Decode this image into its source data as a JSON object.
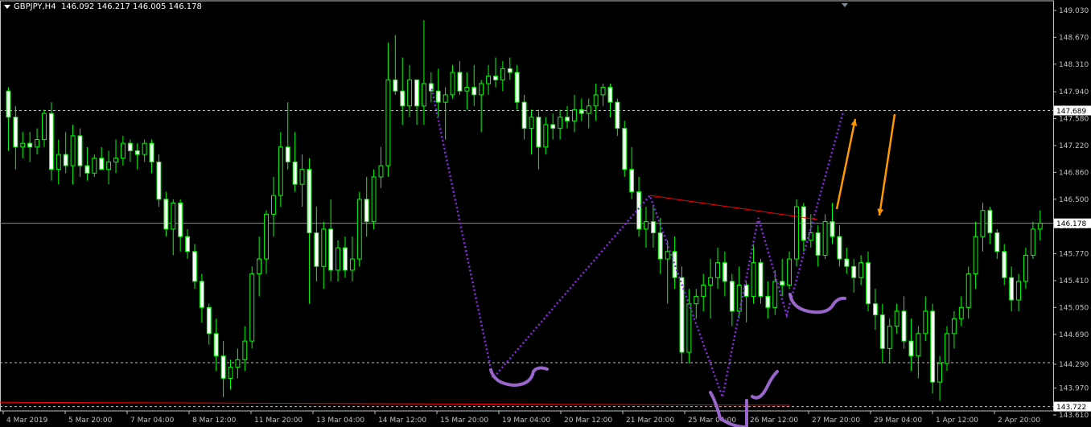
{
  "header": {
    "symbol_timeframe": "GBPJPY,H4",
    "ohlc": "146.092 146.217 146.005 146.178"
  },
  "colors": {
    "background": "#000000",
    "axis": "#c0c0c0",
    "candle": "#00ff00",
    "candle_alt": "#ffffff",
    "dashed_level": "#c0c0c0",
    "bid_line": "#7f8c99",
    "support_line": "#ff0000",
    "pattern": "#8a2be2",
    "handwriting": "#9966cc",
    "arrow": "#ff9900"
  },
  "chart_data": {
    "type": "candlestick",
    "symbol": "GBPJPY",
    "timeframe": "H4",
    "ylim": [
      143.61,
      149.03
    ],
    "yticks": [
      "149.030",
      "148.670",
      "148.310",
      "147.940",
      "147.580",
      "147.220",
      "146.860",
      "146.500",
      "146.140",
      "145.770",
      "145.410",
      "145.050",
      "144.690",
      "144.290",
      "143.970",
      "143.610"
    ],
    "xticks": [
      "4 Mar 2019",
      "5 Mar 20:00",
      "7 Mar 04:00",
      "8 Mar 12:00",
      "11 Mar 20:00",
      "13 Mar 04:00",
      "14 Mar 12:00",
      "15 Mar 20:00",
      "19 Mar 04:00",
      "20 Mar 12:00",
      "21 Mar 20:00",
      "25 Mar 04:00",
      "26 Mar 12:00",
      "27 Mar 20:00",
      "29 Mar 04:00",
      "1 Apr 12:00",
      "2 Apr 20:00"
    ],
    "price_labels": [
      {
        "label": "147.689",
        "value": 147.689,
        "style": "dashed"
      },
      {
        "label": "146.178",
        "value": 146.178,
        "style": "bid"
      },
      {
        "label": "143.722",
        "value": 143.722,
        "style": "dashed"
      }
    ],
    "levels": [
      147.689,
      144.31,
      143.722
    ],
    "bid": 146.178,
    "candles": [
      [
        147.95,
        148.0,
        147.15,
        147.6
      ],
      [
        147.6,
        147.75,
        146.9,
        147.2
      ],
      [
        147.2,
        147.4,
        147.05,
        147.25
      ],
      [
        147.25,
        147.4,
        147.0,
        147.2
      ],
      [
        147.2,
        147.45,
        147.1,
        147.3
      ],
      [
        147.3,
        147.7,
        147.2,
        147.65
      ],
      [
        147.65,
        147.8,
        146.75,
        146.9
      ],
      [
        146.9,
        147.3,
        146.7,
        147.1
      ],
      [
        147.1,
        147.4,
        146.85,
        146.95
      ],
      [
        146.95,
        147.5,
        146.7,
        147.35
      ],
      [
        147.35,
        147.45,
        146.8,
        146.95
      ],
      [
        146.95,
        147.2,
        146.75,
        146.85
      ],
      [
        146.85,
        147.1,
        146.8,
        147.05
      ],
      [
        147.05,
        147.2,
        146.95,
        146.9
      ],
      [
        146.9,
        147.15,
        146.7,
        147.0
      ],
      [
        147.0,
        147.3,
        146.85,
        147.05
      ],
      [
        147.05,
        147.35,
        146.95,
        147.25
      ],
      [
        147.25,
        147.3,
        147.0,
        147.15
      ],
      [
        147.15,
        147.25,
        146.9,
        147.1
      ],
      [
        147.1,
        147.3,
        147.0,
        147.25
      ],
      [
        147.25,
        147.3,
        146.85,
        147.0
      ],
      [
        147.0,
        147.1,
        146.4,
        146.5
      ],
      [
        146.5,
        146.6,
        146.0,
        146.1
      ],
      [
        146.1,
        146.5,
        145.75,
        146.45
      ],
      [
        146.45,
        146.5,
        145.8,
        146.0
      ],
      [
        146.0,
        146.1,
        145.7,
        145.8
      ],
      [
        145.8,
        145.9,
        145.3,
        145.4
      ],
      [
        145.4,
        145.5,
        144.85,
        145.05
      ],
      [
        145.05,
        145.1,
        144.55,
        144.7
      ],
      [
        144.7,
        144.9,
        144.2,
        144.4
      ],
      [
        144.4,
        144.6,
        143.85,
        144.1
      ],
      [
        144.1,
        144.35,
        143.95,
        144.25
      ],
      [
        144.25,
        144.5,
        144.1,
        144.35
      ],
      [
        144.35,
        144.8,
        144.2,
        144.6
      ],
      [
        144.6,
        145.6,
        144.5,
        145.5
      ],
      [
        145.5,
        146.0,
        145.2,
        145.7
      ],
      [
        145.7,
        146.35,
        145.5,
        146.3
      ],
      [
        146.3,
        146.8,
        146.0,
        146.55
      ],
      [
        146.55,
        147.4,
        146.4,
        147.2
      ],
      [
        147.2,
        147.8,
        146.9,
        147.0
      ],
      [
        147.0,
        147.4,
        146.6,
        146.7
      ],
      [
        146.7,
        147.1,
        146.4,
        146.9
      ],
      [
        146.9,
        147.05,
        145.1,
        146.05
      ],
      [
        146.05,
        146.4,
        145.4,
        145.6
      ],
      [
        145.6,
        146.2,
        145.3,
        146.1
      ],
      [
        146.1,
        146.5,
        145.4,
        145.55
      ],
      [
        145.55,
        145.95,
        145.4,
        145.85
      ],
      [
        145.85,
        146.0,
        145.45,
        145.55
      ],
      [
        145.55,
        146.0,
        145.4,
        145.7
      ],
      [
        145.7,
        146.6,
        145.6,
        146.5
      ],
      [
        146.5,
        146.8,
        146.0,
        146.2
      ],
      [
        146.2,
        146.9,
        146.1,
        146.8
      ],
      [
        146.8,
        147.2,
        146.65,
        146.95
      ],
      [
        146.95,
        148.6,
        146.8,
        148.1
      ],
      [
        148.1,
        148.7,
        147.9,
        147.95
      ],
      [
        147.95,
        148.4,
        147.5,
        147.75
      ],
      [
        147.75,
        148.3,
        147.6,
        148.1
      ],
      [
        148.1,
        148.1,
        147.5,
        147.75
      ],
      [
        147.75,
        148.9,
        147.5,
        148.05
      ],
      [
        148.05,
        148.2,
        147.8,
        147.95
      ],
      [
        147.95,
        148.25,
        147.6,
        147.8
      ],
      [
        147.8,
        148.0,
        147.3,
        147.9
      ],
      [
        147.9,
        148.3,
        147.85,
        148.2
      ],
      [
        148.2,
        148.35,
        147.9,
        147.95
      ],
      [
        147.95,
        148.2,
        147.7,
        148.0
      ],
      [
        148.0,
        148.3,
        147.75,
        147.9
      ],
      [
        147.9,
        148.1,
        147.4,
        148.05
      ],
      [
        148.05,
        148.3,
        147.9,
        148.15
      ],
      [
        148.15,
        148.4,
        148.0,
        148.1
      ],
      [
        148.1,
        148.35,
        147.95,
        148.25
      ],
      [
        148.25,
        148.4,
        148.1,
        148.2
      ],
      [
        148.2,
        148.3,
        147.7,
        147.8
      ],
      [
        147.8,
        147.9,
        147.3,
        147.45
      ],
      [
        147.45,
        147.7,
        147.1,
        147.6
      ],
      [
        147.6,
        147.7,
        146.9,
        147.2
      ],
      [
        147.2,
        147.6,
        147.1,
        147.5
      ],
      [
        147.5,
        147.65,
        147.3,
        147.45
      ],
      [
        147.45,
        147.7,
        147.3,
        147.6
      ],
      [
        147.6,
        147.75,
        147.45,
        147.55
      ],
      [
        147.55,
        147.9,
        147.4,
        147.7
      ],
      [
        147.7,
        147.85,
        147.55,
        147.65
      ],
      [
        147.65,
        147.85,
        147.45,
        147.75
      ],
      [
        147.75,
        148.05,
        147.55,
        147.9
      ],
      [
        147.9,
        148.05,
        147.75,
        148.0
      ],
      [
        148.0,
        148.05,
        147.6,
        147.8
      ],
      [
        147.8,
        147.85,
        147.35,
        147.45
      ],
      [
        147.45,
        147.55,
        146.8,
        146.9
      ],
      [
        146.9,
        147.2,
        146.5,
        146.6
      ],
      [
        146.6,
        146.8,
        146.0,
        146.1
      ],
      [
        146.1,
        146.4,
        145.85,
        146.2
      ],
      [
        146.2,
        146.4,
        145.85,
        146.05
      ],
      [
        146.05,
        146.25,
        145.5,
        145.7
      ],
      [
        145.7,
        145.95,
        145.1,
        145.8
      ],
      [
        145.8,
        146.0,
        145.3,
        145.45
      ],
      [
        145.45,
        145.6,
        144.3,
        144.45
      ],
      [
        144.45,
        145.3,
        144.3,
        145.1
      ],
      [
        145.1,
        145.3,
        144.9,
        145.2
      ],
      [
        145.2,
        145.5,
        145.0,
        145.35
      ],
      [
        145.35,
        145.7,
        144.9,
        145.45
      ],
      [
        145.45,
        145.85,
        145.3,
        145.65
      ],
      [
        145.65,
        145.8,
        145.2,
        145.4
      ],
      [
        145.4,
        145.5,
        144.8,
        145.0
      ],
      [
        145.0,
        145.6,
        144.9,
        145.35
      ],
      [
        145.35,
        145.4,
        144.85,
        145.2
      ],
      [
        145.2,
        145.9,
        145.1,
        145.65
      ],
      [
        145.65,
        145.7,
        145.1,
        145.2
      ],
      [
        145.2,
        145.4,
        144.9,
        145.05
      ],
      [
        145.05,
        145.55,
        144.95,
        145.4
      ],
      [
        145.4,
        145.7,
        145.2,
        145.35
      ],
      [
        145.35,
        145.8,
        145.3,
        145.7
      ],
      [
        145.7,
        146.5,
        145.6,
        146.4
      ],
      [
        146.4,
        146.45,
        145.8,
        145.95
      ],
      [
        145.95,
        146.3,
        145.85,
        146.05
      ],
      [
        146.05,
        146.15,
        145.6,
        145.75
      ],
      [
        145.75,
        146.3,
        145.7,
        146.2
      ],
      [
        146.2,
        146.45,
        145.9,
        146.0
      ],
      [
        146.0,
        146.15,
        145.6,
        145.7
      ],
      [
        145.7,
        145.85,
        145.5,
        145.6
      ],
      [
        145.6,
        145.7,
        145.25,
        145.45
      ],
      [
        145.45,
        145.75,
        145.35,
        145.65
      ],
      [
        145.65,
        145.8,
        145.0,
        145.1
      ],
      [
        145.1,
        145.3,
        144.75,
        144.95
      ],
      [
        144.95,
        145.1,
        144.3,
        144.5
      ],
      [
        144.5,
        144.9,
        144.3,
        144.8
      ],
      [
        144.8,
        145.1,
        144.7,
        145.0
      ],
      [
        145.0,
        145.2,
        144.5,
        144.6
      ],
      [
        144.6,
        144.9,
        144.2,
        144.4
      ],
      [
        144.4,
        144.8,
        144.1,
        144.7
      ],
      [
        144.7,
        145.2,
        144.6,
        145.0
      ],
      [
        145.0,
        145.1,
        143.9,
        144.05
      ],
      [
        144.05,
        144.4,
        143.8,
        144.3
      ],
      [
        144.3,
        144.8,
        144.2,
        144.7
      ],
      [
        144.7,
        145.0,
        144.5,
        144.9
      ],
      [
        144.9,
        145.2,
        144.8,
        145.05
      ],
      [
        145.05,
        145.6,
        144.9,
        145.5
      ],
      [
        145.5,
        146.2,
        145.3,
        146.0
      ],
      [
        146.0,
        146.45,
        145.8,
        146.35
      ],
      [
        146.35,
        146.4,
        145.9,
        146.05
      ],
      [
        146.05,
        146.1,
        145.7,
        145.8
      ],
      [
        145.8,
        145.9,
        145.35,
        145.45
      ],
      [
        145.45,
        145.6,
        145.0,
        145.15
      ],
      [
        145.15,
        145.5,
        145.0,
        145.4
      ],
      [
        145.4,
        145.85,
        145.3,
        145.75
      ],
      [
        145.75,
        146.2,
        145.7,
        146.1
      ],
      [
        146.1,
        146.35,
        145.95,
        146.18
      ]
    ]
  },
  "annotations": {
    "zigzag": [
      [
        0.41,
        147.98
      ],
      [
        0.468,
        144.1
      ],
      [
        0.617,
        146.55
      ],
      [
        0.686,
        143.85
      ],
      [
        0.72,
        146.25
      ],
      [
        0.747,
        144.95
      ],
      [
        0.801,
        147.69
      ]
    ],
    "resistance": [
      [
        0.617,
        146.55
      ],
      [
        0.776,
        146.23
      ]
    ]
  }
}
